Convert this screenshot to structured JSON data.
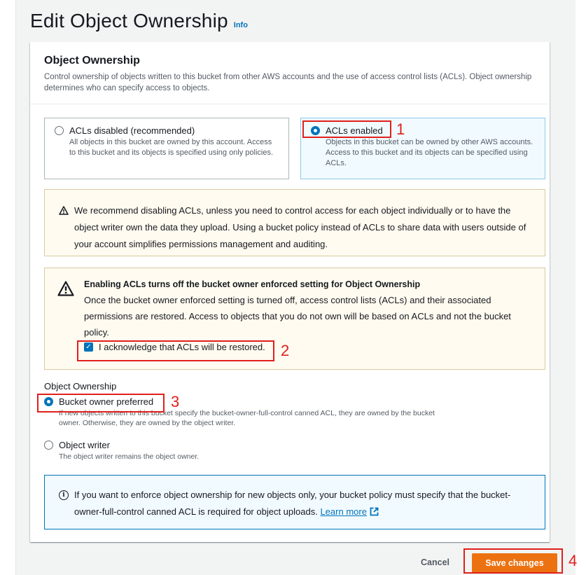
{
  "header": {
    "title": "Edit Object Ownership",
    "info_link": "Info"
  },
  "panel": {
    "title": "Object Ownership",
    "description": "Control ownership of objects written to this bucket from other AWS accounts and the use of access control lists (ACLs). Object ownership determines who can specify access to objects."
  },
  "acl_options": [
    {
      "label": "ACLs disabled (recommended)",
      "description": "All objects in this bucket are owned by this account. Access to this bucket and its objects is specified using only policies.",
      "selected": false
    },
    {
      "label": "ACLs enabled",
      "description": "Objects in this bucket can be owned by other AWS accounts. Access to this bucket and its objects can be specified using ACLs.",
      "selected": true
    }
  ],
  "recommend_alert": {
    "text": "We recommend disabling ACLs, unless you need to control access for each object individually or to have the object writer own the data they upload. Using a bucket policy instead of ACLs to share data with users outside of your account simplifies permissions management and auditing."
  },
  "enable_alert": {
    "heading": "Enabling ACLs turns off the bucket owner enforced setting for Object Ownership",
    "text": "Once the bucket owner enforced setting is turned off, access control lists (ACLs) and their associated permissions are restored. Access to objects that you do not own will be based on ACLs and not the bucket policy.",
    "acknowledge_label": "I acknowledge that ACLs will be restored.",
    "acknowledge_checked": true
  },
  "ownership": {
    "label": "Object Ownership",
    "options": [
      {
        "label": "Bucket owner preferred",
        "description": "If new objects written to this bucket specify the bucket-owner-full-control canned ACL, they are owned by the bucket owner. Otherwise, they are owned by the object writer.",
        "selected": true
      },
      {
        "label": "Object writer",
        "description": "The object writer remains the object owner.",
        "selected": false
      }
    ]
  },
  "info_alert": {
    "text": "If you want to enforce object ownership for new objects only, your bucket policy must specify that the bucket-owner-full-control canned ACL is required for object uploads.",
    "link": "Learn more"
  },
  "footer": {
    "cancel_label": "Cancel",
    "save_label": "Save changes"
  },
  "annotations": [
    "1",
    "2",
    "3",
    "4"
  ],
  "colors": {
    "accent": "#0073bb",
    "primary_button": "#ec7211",
    "warning_bg": "#fffbf0",
    "annotation_red": "#e0201b"
  }
}
